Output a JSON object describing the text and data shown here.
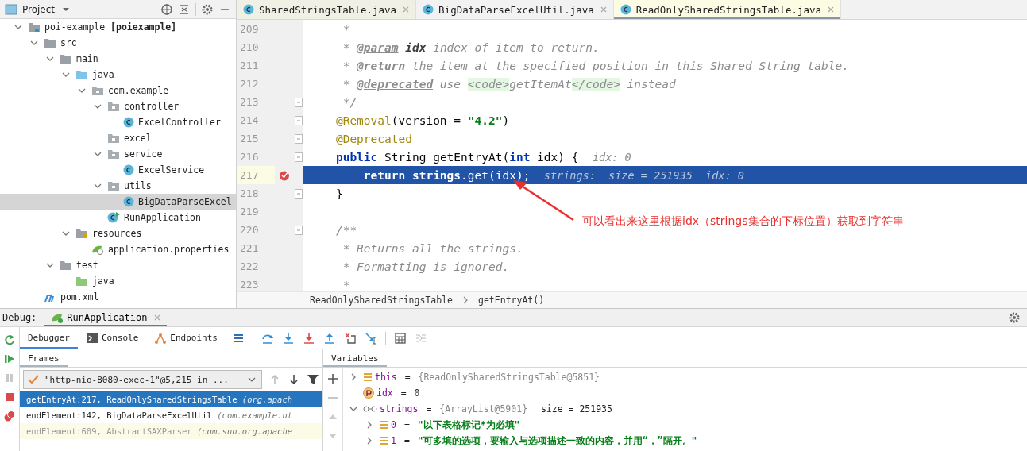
{
  "project_panel": {
    "title": "Project",
    "tree": [
      {
        "label": "poi-example **[poiexample]**",
        "kind": "module",
        "expanded": true,
        "selected": false,
        "children": [
          {
            "label": "src",
            "kind": "folder",
            "expanded": true,
            "selected": false,
            "children": [
              {
                "label": "main",
                "kind": "folder",
                "expanded": true,
                "selected": false,
                "children": [
                  {
                    "label": "java",
                    "kind": "source",
                    "expanded": true,
                    "selected": false,
                    "children": [
                      {
                        "label": "com.example",
                        "kind": "package",
                        "expanded": true,
                        "selected": false,
                        "children": [
                          {
                            "label": "controller",
                            "kind": "package",
                            "expanded": true,
                            "selected": false,
                            "children": [
                              {
                                "label": "ExcelController",
                                "kind": "class",
                                "selected": false
                              }
                            ]
                          },
                          {
                            "label": "excel",
                            "kind": "package",
                            "selected": false
                          },
                          {
                            "label": "service",
                            "kind": "package",
                            "expanded": true,
                            "selected": false,
                            "children": [
                              {
                                "label": "ExcelService",
                                "kind": "class",
                                "selected": false
                              }
                            ]
                          },
                          {
                            "label": "utils",
                            "kind": "package",
                            "expanded": true,
                            "selected": false,
                            "children": [
                              {
                                "label": "BigDataParseExcel",
                                "kind": "class",
                                "selected": true
                              }
                            ]
                          },
                          {
                            "label": "RunApplication",
                            "kind": "run-class",
                            "selected": false
                          }
                        ]
                      }
                    ]
                  },
                  {
                    "label": "resources",
                    "kind": "resources",
                    "expanded": true,
                    "selected": false,
                    "children": [
                      {
                        "label": "application.properties",
                        "kind": "properties",
                        "selected": false
                      }
                    ]
                  }
                ]
              },
              {
                "label": "test",
                "kind": "folder",
                "expanded": true,
                "selected": false,
                "children": [
                  {
                    "label": "java",
                    "kind": "test-source",
                    "selected": false
                  }
                ]
              }
            ]
          },
          {
            "label": "pom.xml",
            "kind": "maven",
            "selected": false
          }
        ]
      }
    ]
  },
  "editor": {
    "tabs": [
      {
        "label": "SharedStringsTable.java",
        "selected": false
      },
      {
        "label": "BigDataParseExcelUtil.java",
        "selected": false
      },
      {
        "label": "ReadOnlySharedStringsTable.java",
        "selected": true
      }
    ],
    "lines": [
      {
        "number": "209",
        "selected": false,
        "breakpoint": false,
        "fold": false,
        "tokens": [
          {
            "kind": "comment",
            "text": "     *"
          }
        ]
      },
      {
        "number": "210",
        "selected": false,
        "breakpoint": false,
        "fold": false,
        "tokens": [
          {
            "kind": "comment",
            "text": "     * "
          },
          {
            "kind": "doctag",
            "text": "@param"
          },
          {
            "kind": "docparam",
            "text": " idx"
          },
          {
            "kind": "comment",
            "text": " index of item to return."
          }
        ]
      },
      {
        "number": "211",
        "selected": false,
        "breakpoint": false,
        "fold": false,
        "tokens": [
          {
            "kind": "comment",
            "text": "     * "
          },
          {
            "kind": "doctag",
            "text": "@return"
          },
          {
            "kind": "comment",
            "text": " the item at the specified position in this Shared String table."
          }
        ]
      },
      {
        "number": "212",
        "selected": false,
        "breakpoint": false,
        "fold": false,
        "tokens": [
          {
            "kind": "comment",
            "text": "     * "
          },
          {
            "kind": "doctag",
            "text": "@deprecated"
          },
          {
            "kind": "comment",
            "text": " use "
          },
          {
            "kind": "codetag",
            "text": "<code>"
          },
          {
            "kind": "comment",
            "text": "getItemAt"
          },
          {
            "kind": "codetag",
            "text": "</code>"
          },
          {
            "kind": "comment",
            "text": " instead"
          }
        ]
      },
      {
        "number": "213",
        "selected": false,
        "breakpoint": false,
        "fold": true,
        "tokens": [
          {
            "kind": "comment",
            "text": "     */"
          }
        ]
      },
      {
        "number": "214",
        "selected": false,
        "breakpoint": false,
        "fold": true,
        "tokens": [
          {
            "kind": "annotation",
            "text": "    @Removal"
          },
          {
            "kind": "plain",
            "text": "(version = "
          },
          {
            "kind": "string",
            "text": "\"4.2\""
          },
          {
            "kind": "plain",
            "text": ")"
          }
        ]
      },
      {
        "number": "215",
        "selected": false,
        "breakpoint": false,
        "fold": true,
        "tokens": [
          {
            "kind": "annotation",
            "text": "    @Deprecated"
          }
        ]
      },
      {
        "number": "216",
        "selected": false,
        "breakpoint": false,
        "fold": true,
        "tokens": [
          {
            "kind": "keyword",
            "text": "    public"
          },
          {
            "kind": "plain",
            "text": " String getEntryAt("
          },
          {
            "kind": "keyword",
            "text": "int"
          },
          {
            "kind": "plain",
            "text": " idx) {  "
          },
          {
            "kind": "hint",
            "text": "idx: 0"
          }
        ]
      },
      {
        "number": "217",
        "selected": true,
        "breakpoint": true,
        "fold": false,
        "tokens": [
          {
            "kind": "keyword",
            "text": "        return "
          },
          {
            "kind": "field",
            "text": "strings"
          },
          {
            "kind": "plain",
            "text": ".get(idx);  "
          },
          {
            "kind": "hint",
            "text": "strings:  size = 251935  idx: 0"
          }
        ]
      },
      {
        "number": "218",
        "selected": false,
        "breakpoint": false,
        "fold": true,
        "tokens": [
          {
            "kind": "plain",
            "text": "    }"
          }
        ]
      },
      {
        "number": "219",
        "selected": false,
        "breakpoint": false,
        "fold": false
      },
      {
        "number": "220",
        "selected": false,
        "breakpoint": false,
        "fold": true,
        "tokens": [
          {
            "kind": "comment",
            "text": "    /**"
          }
        ]
      },
      {
        "number": "221",
        "selected": false,
        "breakpoint": false,
        "fold": false,
        "tokens": [
          {
            "kind": "comment",
            "text": "     * Returns all the strings."
          }
        ]
      },
      {
        "number": "222",
        "selected": false,
        "breakpoint": false,
        "fold": false,
        "tokens": [
          {
            "kind": "comment",
            "text": "     * Formatting is ignored."
          }
        ]
      },
      {
        "number": "223",
        "selected": false,
        "breakpoint": false,
        "fold": false,
        "tokens": [
          {
            "kind": "comment",
            "text": "     *"
          }
        ]
      }
    ],
    "annotation": {
      "text": "可以看出来这里根据idx（strings集合的下标位置）获取到字符串"
    },
    "breadcrumb": [
      "ReadOnlySharedStringsTable",
      "getEntryAt()"
    ]
  },
  "debug": {
    "label": "Debug:",
    "session": "RunApplication",
    "tabs": [
      {
        "label": "Debugger",
        "kind": "plain",
        "selected": true
      },
      {
        "label": "Console",
        "kind": "console",
        "selected": false
      },
      {
        "label": "Endpoints",
        "kind": "endpoints",
        "selected": false
      }
    ],
    "frames": {
      "title": "Frames",
      "thread": "\"http-nio-8080-exec-1\"@5,215 in ...",
      "items": [
        {
          "method": "getEntryAt:217, ReadOnlySharedStringsTable",
          "package": "(org.apach",
          "kind": "project",
          "selected": true
        },
        {
          "method": "endElement:142, BigDataParseExcelUtil",
          "package": "(com.example.ut",
          "kind": "project",
          "selected": false
        },
        {
          "method": "endElement:609, AbstractSAXParser",
          "package": "(com.sun.org.apache",
          "kind": "library",
          "selected": false
        }
      ]
    },
    "variables": {
      "title": "Variables",
      "items": [
        {
          "name": "this",
          "kind": "field",
          "expanded": false,
          "sep": "=",
          "value": "{ReadOnlySharedStringsTable@5851}"
        },
        {
          "name": "idx",
          "kind": "param",
          "sep": "=",
          "value": "0"
        },
        {
          "name": "strings",
          "kind": "watch",
          "expanded": true,
          "sep": "=",
          "value": "{ArrayList@5901}",
          "extra": "size = 251935",
          "children": [
            {
              "name": "0",
              "kind": "element",
              "expanded": false,
              "sep": "=",
              "value": "\"以下表格标记*为必填\""
            },
            {
              "name": "1",
              "kind": "element",
              "expanded": false,
              "sep": "=",
              "value": "\"可多填的选项，要输入与选项描述一致的内容，并用“，”隔开。\""
            }
          ]
        }
      ]
    }
  }
}
